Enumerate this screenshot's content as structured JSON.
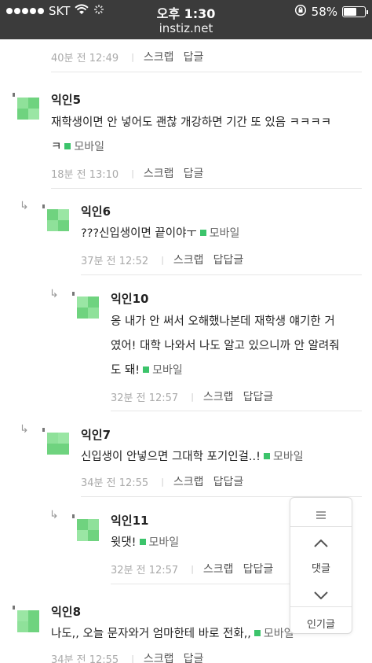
{
  "status_bar": {
    "carrier": "SKT",
    "time": "오후 1:30",
    "battery": "58%",
    "battery_level": 0.58
  },
  "url": "instiz.net",
  "top_meta": {
    "time": "40분 전  12:49",
    "scrap": "스크랩",
    "reply": "답글"
  },
  "comments": [
    {
      "name": "익인5",
      "line1": "재학생이면 안 넣어도 괜찮 개강하면 기간 또 있음 ㅋㅋㅋㅋ",
      "line2": "ㅋ",
      "mobile": "모바일",
      "time": "18분 전  13:10",
      "scrap": "스크랩",
      "reply": "답글"
    },
    {
      "name": "익인6",
      "line1": "???신입생이면 끝이야ㅜ",
      "mobile": "모바일",
      "time": "37분 전  12:52",
      "scrap": "스크랩",
      "reply": "답답글"
    },
    {
      "name": "익인10",
      "line1": "옹 내가 안 써서 오해했나본데 재학생 얘기한 거",
      "line2": "였어! 대학 나와서 나도 알고 있으니까 안 알려줘",
      "line3": "도 돼!",
      "mobile": "모바일",
      "time": "32분 전  12:57",
      "scrap": "스크랩",
      "reply": "답답글"
    },
    {
      "name": "익인7",
      "line1": "신입생이 안넣으면 그대학 포기인걸..!",
      "mobile": "모바일",
      "time": "34분 전  12:55",
      "scrap": "스크랩",
      "reply": "답답글"
    },
    {
      "name": "익인11",
      "line1": "윗댓!",
      "mobile": "모바일",
      "time": "32분 전  12:57",
      "scrap": "스크랩",
      "reply": "답답글"
    },
    {
      "name": "익인8",
      "line1": "나도,, 오늘 문자와거 엄마한테 바로 전화,,",
      "mobile": "모바일",
      "time": "34분 전  12:55",
      "scrap": "스크랩",
      "reply": "답글"
    }
  ],
  "panel": {
    "comments_label": "댓글",
    "popular_label": "인기글"
  },
  "icons": [
    "wifi-icon",
    "loading-icon",
    "rotation-lock-icon",
    "battery-icon",
    "reply-arrow-icon",
    "menu-icon",
    "chevron-up-icon",
    "chevron-down-icon"
  ],
  "colors": {
    "mobile_badge": "#3cc46b",
    "avatar": "#7ed98a",
    "top_bar": "#3b3b3b"
  }
}
